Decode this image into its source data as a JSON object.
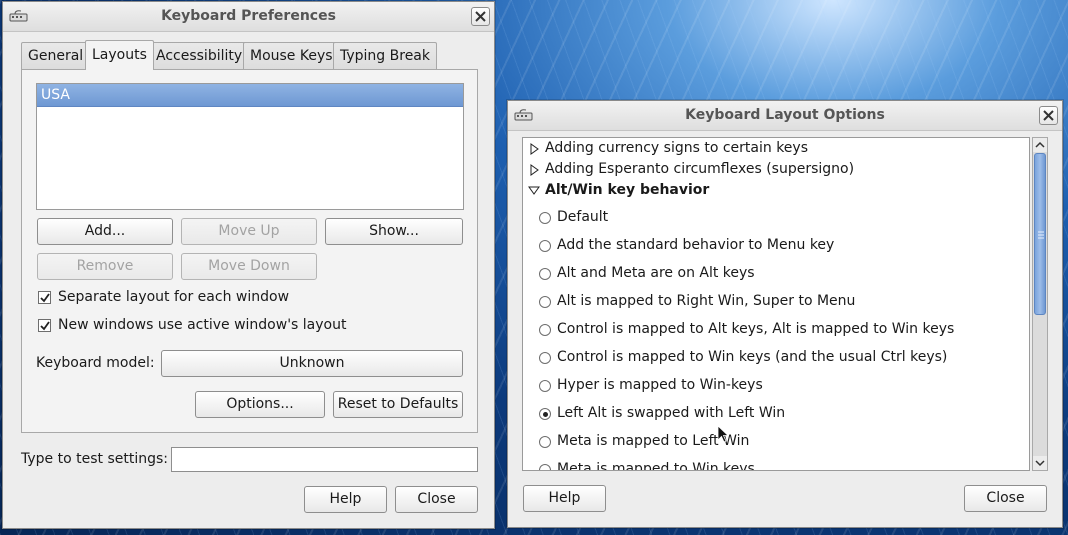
{
  "prefs_window": {
    "title": "Keyboard Preferences",
    "tabs": [
      {
        "label": "General"
      },
      {
        "label": "Layouts"
      },
      {
        "label": "Accessibility"
      },
      {
        "label": "Mouse Keys"
      },
      {
        "label": "Typing Break"
      }
    ],
    "active_tab": "Layouts",
    "layouts": [
      {
        "label": "USA",
        "selected": true
      }
    ],
    "buttons": {
      "add": "Add...",
      "move_up": "Move Up",
      "show": "Show...",
      "remove": "Remove",
      "move_down": "Move Down",
      "options": "Options...",
      "reset": "Reset to Defaults",
      "help": "Help",
      "close": "Close"
    },
    "checkboxes": [
      {
        "label": "Separate layout for each window",
        "checked": true
      },
      {
        "label": "New windows use active window's layout",
        "checked": true
      }
    ],
    "keyboard_model": {
      "label": "Keyboard model:",
      "value": "Unknown"
    },
    "test_settings": {
      "label": "Type to test settings:",
      "value": ""
    }
  },
  "options_window": {
    "title": "Keyboard Layout Options",
    "groups": [
      {
        "label": "Adding currency signs to certain keys",
        "expanded": false
      },
      {
        "label": "Adding Esperanto circumflexes (supersigno)",
        "expanded": false
      },
      {
        "label": "Alt/Win key behavior",
        "expanded": true
      }
    ],
    "options": [
      {
        "label": "Default",
        "selected": false
      },
      {
        "label": "Add the standard behavior to Menu key",
        "selected": false
      },
      {
        "label": "Alt and Meta are on Alt keys",
        "selected": false
      },
      {
        "label": "Alt is mapped to Right Win, Super to Menu",
        "selected": false
      },
      {
        "label": "Control is mapped to Alt keys, Alt is mapped to Win keys",
        "selected": false
      },
      {
        "label": "Control is mapped to Win keys (and the usual Ctrl keys)",
        "selected": false
      },
      {
        "label": "Hyper is mapped to Win-keys",
        "selected": false
      },
      {
        "label": "Left Alt is swapped with Left Win",
        "selected": true
      },
      {
        "label": "Meta is mapped to Left Win",
        "selected": false
      },
      {
        "label": "Meta is mapped to Win keys",
        "selected": false
      }
    ],
    "buttons": {
      "help": "Help",
      "close": "Close"
    }
  },
  "colors": {
    "selection": "#7aa2db",
    "window_bg": "#ededed",
    "title_text": "#555555"
  },
  "icons": [
    "keyboard-icon",
    "close-icon",
    "triangle-right-icon",
    "triangle-down-icon",
    "checkmark-icon",
    "mouse-pointer-icon"
  ]
}
